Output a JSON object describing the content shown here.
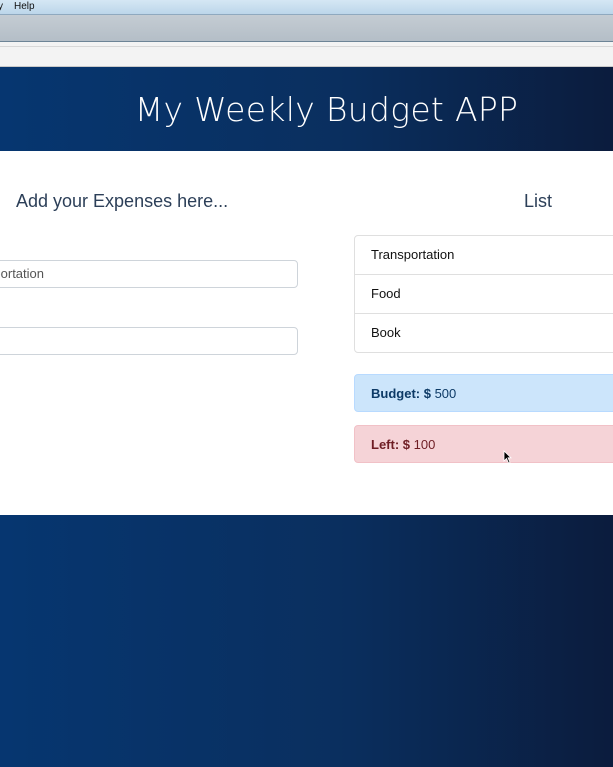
{
  "menubar": {
    "items": [
      "y",
      "Help"
    ]
  },
  "app": {
    "title": "My Weekly Budget APP"
  },
  "form": {
    "heading": "Add your Expenses here...",
    "expense_input_value": "Transportation",
    "amount_input_value": ""
  },
  "list": {
    "heading": "List",
    "items": [
      "Transportation",
      "Food",
      "Book"
    ]
  },
  "budget": {
    "label": "Budget: $",
    "value": "500"
  },
  "left": {
    "label": "Left: $",
    "value": "100"
  },
  "colors": {
    "header_gradient_start": "#063670",
    "header_gradient_end": "#0b1c3d",
    "budget_alert_bg": "#cce5fb",
    "left_alert_bg": "#f5d3d7"
  }
}
